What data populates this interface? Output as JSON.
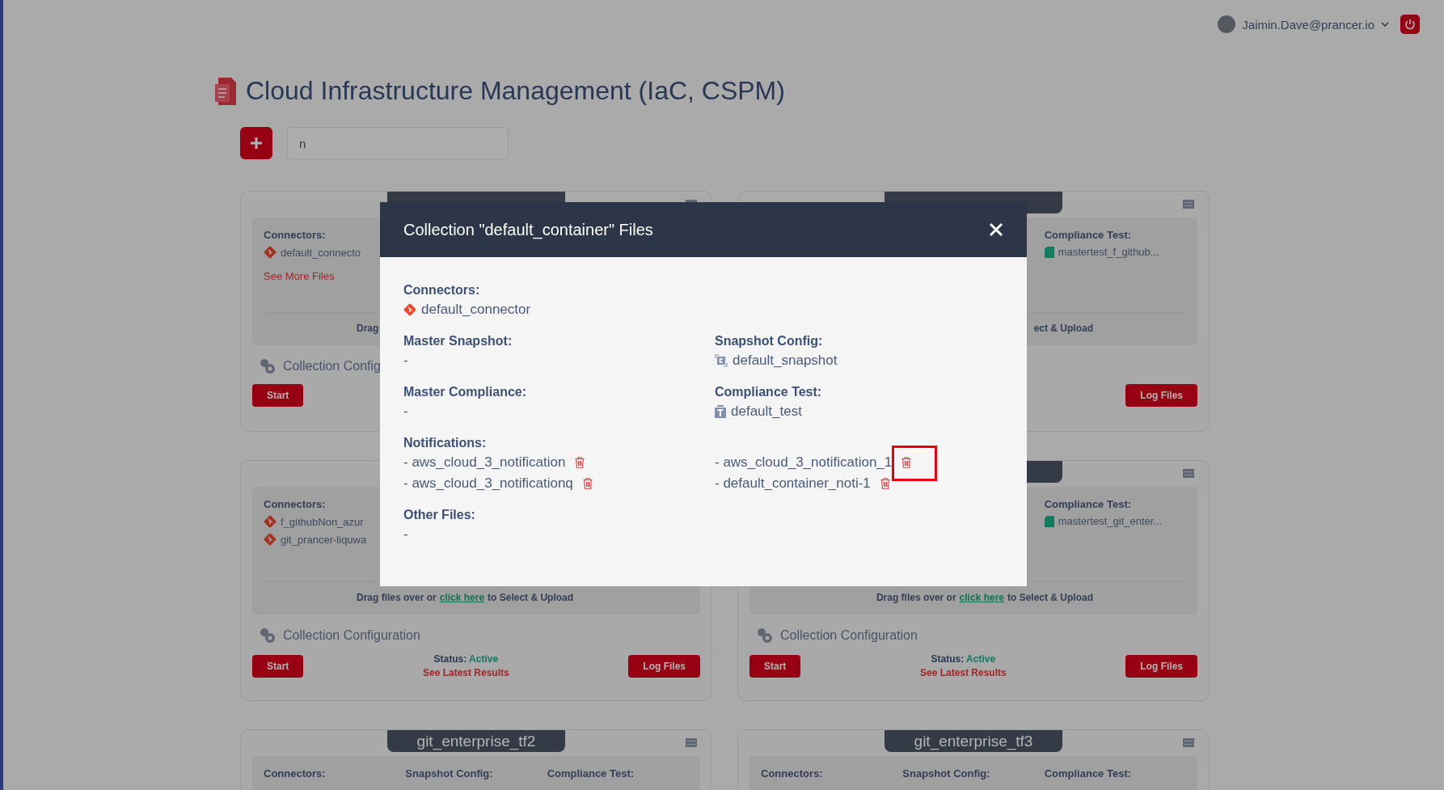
{
  "user": {
    "email": "Jaimin.Dave@prancer.io"
  },
  "page": {
    "title": "Cloud Infrastructure Management (IaC, CSPM)",
    "search": {
      "value": "n"
    }
  },
  "cards": [
    {
      "connectors_label": "Connectors:",
      "connectors": [
        "default_connecto"
      ],
      "more_files": "See More Files",
      "drop": {
        "before": "Drag"
      },
      "config": "Collection Config",
      "start": "Start"
    },
    {
      "compliance_label": "Compliance Test:",
      "compliance": [
        "mastertest_f_github..."
      ],
      "drop": {
        "after": "ect & Upload"
      },
      "log": "Log Files"
    },
    {
      "connectors_label": "Connectors:",
      "connectors": [
        "f_githubNon_azur",
        "git_prancer-liquwa"
      ],
      "drop": {
        "before": "Drag files over or",
        "link": "click here",
        "after": "to Select & Upload"
      },
      "config": "Collection Configuration",
      "start": "Start",
      "status_label": "Status:",
      "status": "Active",
      "results": "See Latest Results",
      "log": "Log Files"
    },
    {
      "compliance_label": "Compliance Test:",
      "compliance": [
        "mastertest_git_enter..."
      ],
      "drop": {
        "before": "Drag files over or",
        "link": "click here",
        "after": "to Select & Upload"
      },
      "config": "Collection Configuration",
      "start": "Start",
      "status_label": "Status:",
      "status": "Active",
      "results": "See Latest Results",
      "log": "Log Files"
    },
    {
      "title": "git_enterprise_tf2",
      "connectors_label": "Connectors:",
      "snapshot_label": "Snapshot Config:",
      "compliance_label": "Compliance Test:"
    },
    {
      "title": "git_enterprise_tf3",
      "connectors_label": "Connectors:",
      "snapshot_label": "Snapshot Config:",
      "compliance_label": "Compliance Test:"
    }
  ],
  "modal": {
    "title": "Collection \"default_container\" Files",
    "rows": [
      {
        "cells": [
          {
            "label": "Connectors:",
            "items": [
              {
                "text": "default_connector",
                "kind": "git",
                "deletable": false,
                "highlighted": false
              }
            ]
          }
        ]
      },
      {
        "cells": [
          {
            "label": "Master Snapshot:",
            "items": [
              {
                "text": "-",
                "kind": "plain",
                "deletable": false,
                "highlighted": false
              }
            ]
          },
          {
            "label": "Snapshot Config:",
            "items": [
              {
                "text": "default_snapshot",
                "kind": "snapshot",
                "deletable": false,
                "highlighted": false
              }
            ]
          }
        ]
      },
      {
        "cells": [
          {
            "label": "Master Compliance:",
            "items": [
              {
                "text": "-",
                "kind": "plain",
                "deletable": false,
                "highlighted": false
              }
            ]
          },
          {
            "label": "Compliance Test:",
            "items": [
              {
                "text": "default_test",
                "kind": "test",
                "deletable": false,
                "highlighted": false
              }
            ]
          }
        ]
      },
      {
        "cells": [
          {
            "label": "Notifications:",
            "items": [
              {
                "text": "- aws_cloud_3_notification",
                "kind": "plain",
                "deletable": true,
                "highlighted": false
              },
              {
                "text": "- aws_cloud_3_notification_1",
                "kind": "plain",
                "deletable": true,
                "highlighted": true
              },
              {
                "text": "- aws_cloud_3_notificationq",
                "kind": "plain",
                "deletable": true,
                "highlighted": false
              },
              {
                "text": "- default_container_noti-1",
                "kind": "plain",
                "deletable": true,
                "highlighted": false
              }
            ]
          }
        ]
      },
      {
        "cells": [
          {
            "label": "Other Files:",
            "items": [
              {
                "text": "-",
                "kind": "plain",
                "deletable": false,
                "highlighted": false
              }
            ]
          }
        ]
      }
    ]
  }
}
